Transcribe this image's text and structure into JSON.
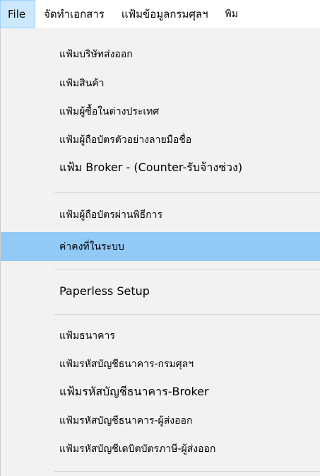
{
  "menubar": {
    "items": [
      {
        "label": "File"
      },
      {
        "label": "จัดทำเอกสาร"
      },
      {
        "label": "แฟ้มข้อมูลกรมศุลฯ"
      },
      {
        "label": "พิม"
      }
    ]
  },
  "file_menu": {
    "groups": [
      {
        "items": [
          {
            "label": "แฟ้มบริษัทส่งออก"
          },
          {
            "label": "แฟ้มสินค้า"
          },
          {
            "label": "แฟ้มผู้ซื้อในต่างประเทศ"
          },
          {
            "label": "แฟ้มผู้ถือบัตรตัวอย่างลายมือชื่อ"
          },
          {
            "label": "แฟ้ม Broker - (Counter-รับจ้างช่วง)"
          }
        ]
      },
      {
        "items": [
          {
            "label": "แฟ้มผู้ถือบัตรผ่านพิธีการ"
          },
          {
            "label": "ค่าคงที่ในระบบ"
          }
        ]
      },
      {
        "items": [
          {
            "label": "Paperless Setup"
          }
        ]
      },
      {
        "items": [
          {
            "label": "แฟ้มธนาคาร"
          },
          {
            "label": "แฟ้มรหัสบัญชีธนาคาร-กรมศุลฯ"
          },
          {
            "label": "แฟ้มรหัสบัญชีธนาคาร-Broker"
          },
          {
            "label": "แฟ้มรหัสบัญชีธนาคาร-ผู้ส่งออก"
          },
          {
            "label": "แฟ้มรหัสบัญชีเดบิตบัตรภาษี-ผู้ส่งออก"
          }
        ]
      }
    ],
    "highlighted": "ค่าคงที่ในระบบ"
  },
  "colors": {
    "menubar_active_bg": "#cce8ff",
    "menu_bg": "#f2f2f2",
    "highlight_bg": "#91c9f7"
  }
}
